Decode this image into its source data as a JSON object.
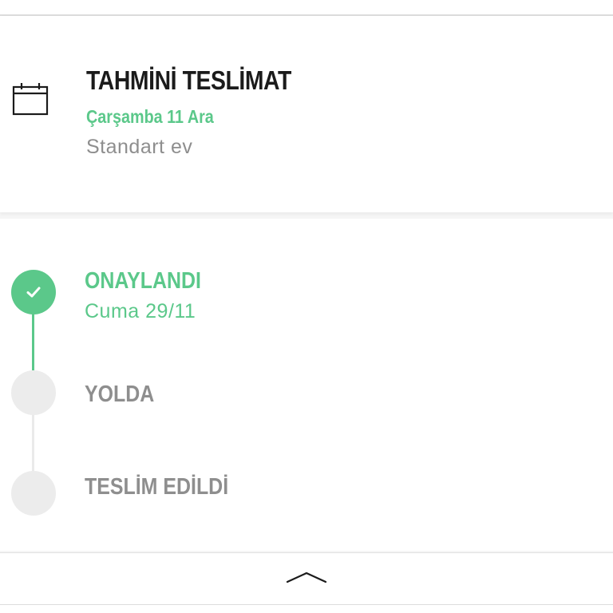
{
  "delivery": {
    "title": "TAHMİNİ TESLİMAT",
    "date": "Çarşamba 11 Ara",
    "type": "Standart ev",
    "icon": "calendar-icon"
  },
  "tracking": {
    "steps": [
      {
        "label": "ONAYLANDI",
        "date": "Cuma 29/11",
        "status": "done"
      },
      {
        "label": "YOLDA",
        "status": "pending"
      },
      {
        "label": "TESLİM EDİLDİ",
        "status": "pending"
      }
    ]
  },
  "footer": {
    "toggle_icon": "chevron-up-icon"
  },
  "colors": {
    "accent": "#5bc88a",
    "title": "#1b1b1b",
    "muted": "#8e8e8e",
    "pending_dot": "#ececec"
  }
}
